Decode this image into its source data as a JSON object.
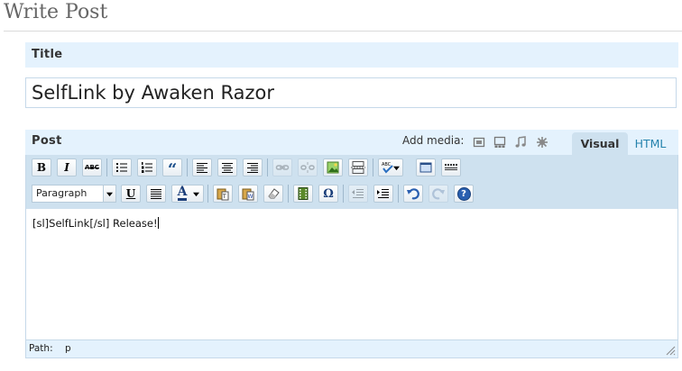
{
  "page": {
    "title": "Write Post"
  },
  "title_box": {
    "label": "Title",
    "value": "SelfLink by Awaken Razor"
  },
  "post_box": {
    "label": "Post",
    "add_media_label": "Add media:",
    "media_icons": [
      "image-icon",
      "gallery-icon",
      "audio-icon",
      "media-icon"
    ],
    "tabs": [
      {
        "label": "Visual",
        "active": true
      },
      {
        "label": "HTML",
        "active": false
      }
    ]
  },
  "toolbar": {
    "row1": [
      "bold",
      "italic",
      "strikethrough",
      "bullet-list",
      "numbered-list",
      "blockquote",
      "align-left",
      "align-center",
      "align-right",
      "link",
      "unlink",
      "image",
      "more",
      "spellcheck",
      "fullscreen",
      "kitchen-sink"
    ],
    "row2": [
      "underline",
      "justify",
      "text-color",
      "paste-text",
      "paste-word",
      "remove-format",
      "embed-media",
      "special-char",
      "outdent",
      "indent",
      "undo",
      "redo",
      "help"
    ],
    "format_value": "Paragraph",
    "bold_glyph": "B",
    "italic_glyph": "I",
    "strike_glyph": "ABC",
    "underline_glyph": "U",
    "textcolor_glyph": "A",
    "special_glyph": "Ω",
    "quote_glyph": "“",
    "help_glyph": "?"
  },
  "editor": {
    "content": "[sl]SelfLink[/sl] Release!"
  },
  "path_bar": {
    "label": "Path:",
    "value": "p"
  },
  "colors": {
    "header_bg": "#e4f2fd",
    "toolbar_bg": "#cee1ef",
    "link": "#2583ad"
  }
}
